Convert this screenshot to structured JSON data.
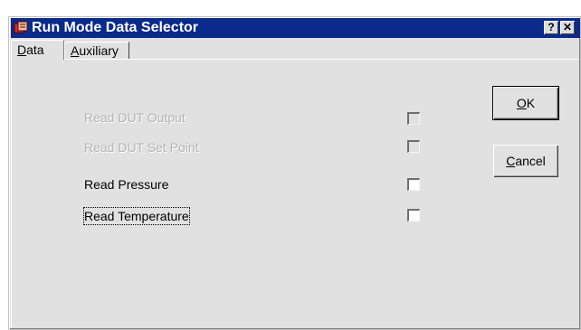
{
  "window": {
    "title": "Run Mode Data Selector",
    "help_button": "?",
    "close_button": "✕",
    "icon": "app-icon"
  },
  "tabs": [
    {
      "label": "Data",
      "underline": "D",
      "rest": "ata",
      "active": true
    },
    {
      "label": "Auxiliary",
      "underline": "A",
      "rest": "uxiliary",
      "active": false
    }
  ],
  "options": [
    {
      "label": "Read DUT Output",
      "enabled": false,
      "checked": false
    },
    {
      "label": "Read DUT Set Point",
      "enabled": false,
      "checked": false
    },
    {
      "label": "Read Pressure",
      "enabled": true,
      "checked": false
    },
    {
      "label": "Read Temperature",
      "enabled": true,
      "checked": false,
      "focused": true
    }
  ],
  "buttons": {
    "ok": {
      "underline": "O",
      "rest": "K"
    },
    "cancel": {
      "underline": "C",
      "rest": "ancel"
    }
  },
  "colors": {
    "titlebar": "#0a2a8c",
    "face": "#e1e1e1",
    "disabled_text": "#b4b4b4"
  }
}
